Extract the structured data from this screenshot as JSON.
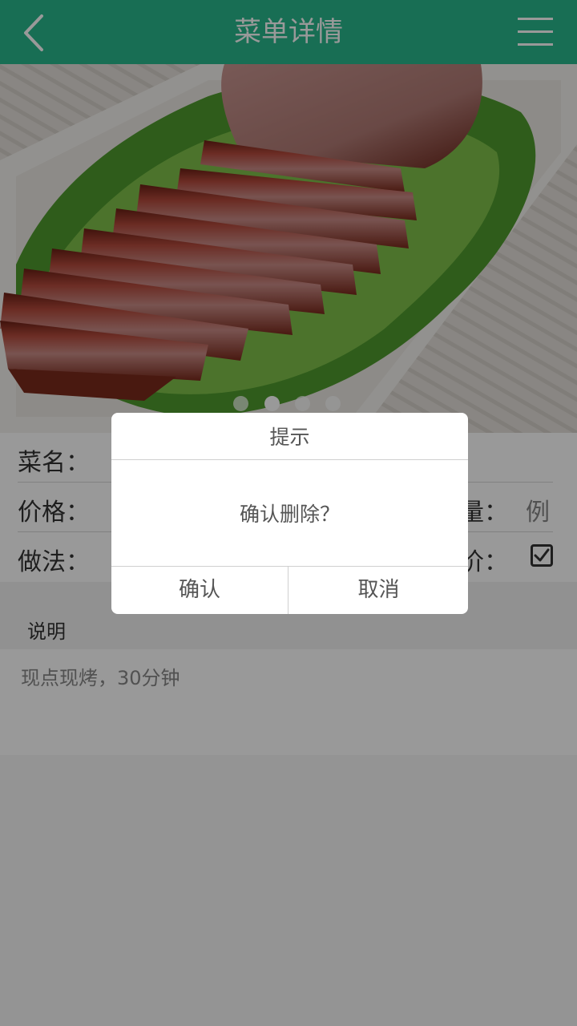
{
  "header": {
    "title": "菜单详情",
    "back_icon": "chevron-left-icon",
    "menu_icon": "hamburger-menu-icon",
    "color": "#28b88c"
  },
  "carousel": {
    "image": "roast-pork-photo",
    "page_count": 4,
    "active_index": 1
  },
  "form": {
    "name_label": "菜名：",
    "price_label": "价格：",
    "unit_label": "量：",
    "unit_value": "例",
    "method_label": "做法：",
    "price_type_label": "价：",
    "price_type_checked": true
  },
  "description": {
    "heading": "说明",
    "text": "现点现烤，30分钟"
  },
  "dialog": {
    "title": "提示",
    "message": "确认删除？",
    "confirm_label": "确认",
    "cancel_label": "取消"
  }
}
